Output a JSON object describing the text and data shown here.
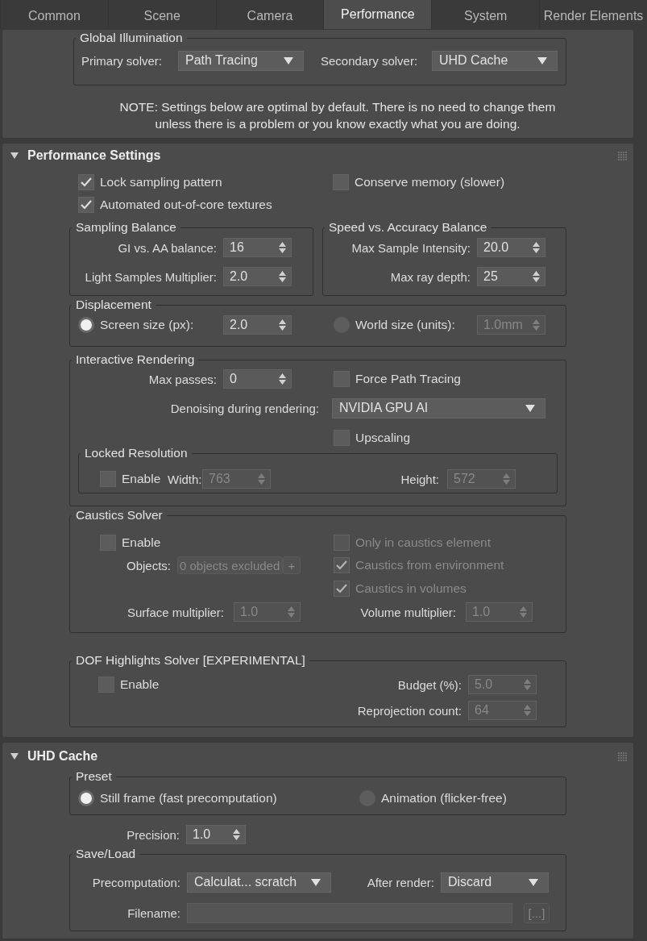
{
  "tabs": [
    {
      "label": "Common",
      "selected": false
    },
    {
      "label": "Scene",
      "selected": false
    },
    {
      "label": "Camera",
      "selected": false
    },
    {
      "label": "Performance",
      "selected": true
    },
    {
      "label": "System",
      "selected": false
    },
    {
      "label": "Render Elements",
      "selected": false
    }
  ],
  "global_illumination": {
    "title": "Global Illumination",
    "primary_solver": {
      "label": "Primary solver:",
      "value": "Path Tracing"
    },
    "secondary_solver": {
      "label": "Secondary solver:",
      "value": "UHD Cache"
    }
  },
  "note": {
    "lines": [
      "NOTE: Settings below are optimal by default. There is no need to change them",
      "unless there is a problem or you know exactly what you are doing."
    ]
  },
  "performance_settings": {
    "title": "Performance Settings",
    "expanded": true,
    "lock_sampling_pattern": {
      "label": "Lock sampling pattern",
      "checked": true
    },
    "conserve_memory": {
      "label": "Conserve memory (slower)",
      "checked": false
    },
    "automated_textures": {
      "label": "Automated out-of-core textures",
      "checked": true
    },
    "sampling_balance": {
      "title": "Sampling Balance",
      "gi_vs_aa_balance": {
        "label": "GI vs. AA balance:",
        "value": "16"
      },
      "light_samples_multiplier": {
        "label": "Light Samples Multiplier:",
        "value": "2.0"
      }
    },
    "speed_vs_accuracy": {
      "title": "Speed vs. Accuracy Balance",
      "max_sample_intensity": {
        "label": "Max Sample Intensity:",
        "value": "20.0"
      },
      "max_ray_depth": {
        "label": "Max ray depth:",
        "value": "25"
      }
    },
    "displacement": {
      "title": "Displacement",
      "modes": [
        {
          "label": "Screen size (px):",
          "selected": true,
          "value": "2.0",
          "disabled": false
        },
        {
          "label": "World size (units):",
          "selected": false,
          "value": "1.0mm",
          "disabled": true
        }
      ]
    },
    "interactive_rendering": {
      "title": "Interactive Rendering",
      "max_passes": {
        "label": "Max passes:",
        "value": "0"
      },
      "force_path_tracing": {
        "label": "Force Path Tracing",
        "checked": false
      },
      "denoising": {
        "label": "Denoising during rendering:",
        "value": "NVIDIA GPU AI"
      },
      "upscaling": {
        "label": "Upscaling",
        "checked": false
      },
      "locked_resolution": {
        "title": "Locked Resolution",
        "enable": {
          "label": "Enable",
          "checked": false
        },
        "width": {
          "label": "Width:",
          "value": "763",
          "disabled": true
        },
        "height": {
          "label": "Height:",
          "value": "572",
          "disabled": true
        }
      }
    },
    "caustics_solver": {
      "title": "Caustics Solver",
      "enable": {
        "label": "Enable",
        "checked": false
      },
      "only_in_caustics_element": {
        "label": "Only in caustics element",
        "checked": false,
        "disabled": true
      },
      "objects": {
        "label": "Objects:",
        "value": "0 objects excluded",
        "button": "+",
        "disabled": true
      },
      "caustics_from_environment": {
        "label": "Caustics from environment",
        "checked": true,
        "disabled": true
      },
      "caustics_in_volumes": {
        "label": "Caustics in volumes",
        "checked": true,
        "disabled": true
      },
      "surface_multiplier": {
        "label": "Surface multiplier:",
        "value": "1.0",
        "disabled": true
      },
      "volume_multiplier": {
        "label": "Volume multiplier:",
        "value": "1.0",
        "disabled": true
      }
    },
    "dof_highlights_solver": {
      "title": "DOF Highlights Solver [EXPERIMENTAL]",
      "enable": {
        "label": "Enable",
        "checked": false
      },
      "budget": {
        "label": "Budget (%):",
        "value": "5.0",
        "disabled": true
      },
      "reprojection_count": {
        "label": "Reprojection count:",
        "value": "64",
        "disabled": true
      }
    }
  },
  "uhd_cache": {
    "title": "UHD Cache",
    "expanded": true,
    "preset": {
      "title": "Preset",
      "options": [
        {
          "label": "Still frame (fast precomputation)",
          "selected": true
        },
        {
          "label": "Animation (flicker-free)",
          "selected": false
        }
      ]
    },
    "precision": {
      "label": "Precision:",
      "value": "1.0"
    },
    "save_load": {
      "title": "Save/Load",
      "precomputation": {
        "label": "Precomputation:",
        "value": "Calculat... scratch"
      },
      "after_render": {
        "label": "After render:",
        "value": "Discard"
      },
      "filename": {
        "label": "Filename:",
        "browse_button": "[...]",
        "disabled": true
      }
    }
  }
}
